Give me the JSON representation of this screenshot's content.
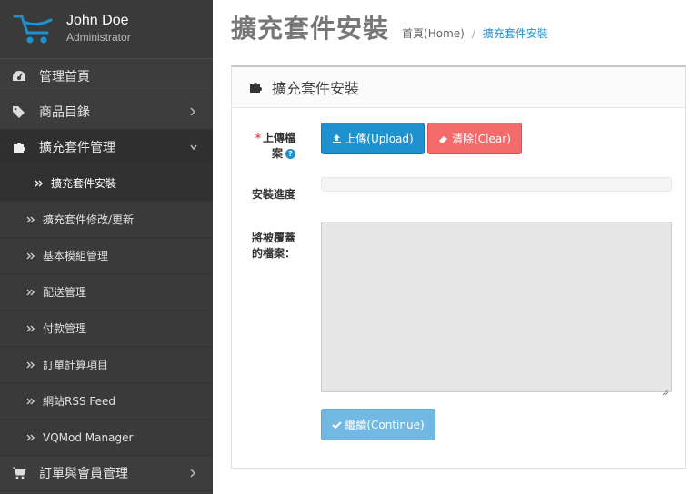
{
  "profile": {
    "name": "John Doe",
    "role": "Administrator"
  },
  "sidebar": {
    "items": [
      {
        "label": "管理首頁"
      },
      {
        "label": "商品目錄"
      },
      {
        "label": "擴充套件管理"
      },
      {
        "label": "訂單與會員管理"
      }
    ],
    "submenu": [
      {
        "label": "擴充套件安裝"
      },
      {
        "label": "擴充套件修改/更新"
      },
      {
        "label": "基本模組管理"
      },
      {
        "label": "配送管理"
      },
      {
        "label": "付款管理"
      },
      {
        "label": "訂單計算項目"
      },
      {
        "label": "網站RSS Feed"
      },
      {
        "label": "VQMod Manager"
      }
    ]
  },
  "header": {
    "title": "擴充套件安裝",
    "breadcrumb": {
      "home": "首頁(Home)",
      "separator": "/",
      "current": "擴充套件安裝"
    }
  },
  "panel": {
    "title": "擴充套件安裝",
    "upload_label_line1": "上傳檔",
    "upload_label_line2": "案",
    "required_mark": "*",
    "help_mark": "?",
    "upload_button": "上傳(Upload)",
    "clear_button": "清除(Clear)",
    "progress_label": "安裝進度",
    "progress_value": 0,
    "overwrite_label_line1": "將被覆蓋",
    "overwrite_label_line2": "的檔案：",
    "continue_button": "繼續(Continue)"
  },
  "colors": {
    "primary": "#1e91cf",
    "danger": "#f56b6b",
    "sidebar": "#3d3d3d"
  }
}
